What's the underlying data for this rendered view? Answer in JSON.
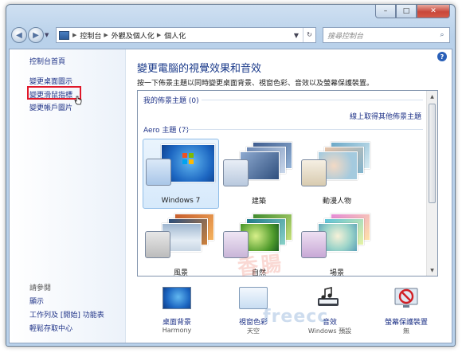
{
  "window": {
    "controls": {
      "minimize": "–",
      "maximize": "□",
      "close": "✕"
    }
  },
  "nav": {
    "breadcrumb": [
      "控制台",
      "外觀及個人化",
      "個人化"
    ],
    "search_placeholder": "搜尋控制台"
  },
  "sidebar": {
    "home": "控制台首頁",
    "links": [
      "變更桌面圖示",
      "變更滑鼠指標",
      "變更帳戶圖片"
    ],
    "see_also_title": "請參閱",
    "see_also": [
      "顯示",
      "工作列及 [開始] 功能表",
      "輕鬆存取中心"
    ]
  },
  "main": {
    "title": "變更電腦的視覺效果和音效",
    "subtitle": "按一下佈景主題以同時變更桌面背景、視窗色彩、音效以及螢幕保護裝置。",
    "my_themes": "我的佈景主題 (0)",
    "online_link": "線上取得其他佈景主題",
    "aero_themes": "Aero 主題 (7)",
    "themes": [
      {
        "label": "Windows 7",
        "selected": true
      },
      {
        "label": "建築",
        "selected": false
      },
      {
        "label": "動漫人物",
        "selected": false
      },
      {
        "label": "風景",
        "selected": false
      },
      {
        "label": "自然",
        "selected": false
      },
      {
        "label": "場景",
        "selected": false
      }
    ]
  },
  "bottom": [
    {
      "label": "桌面背景",
      "sub": "Harmony",
      "icon": "desktop-background-icon"
    },
    {
      "label": "視窗色彩",
      "sub": "天空",
      "icon": "window-color-icon"
    },
    {
      "label": "音效",
      "sub": "Windows 預設",
      "icon": "sounds-icon"
    },
    {
      "label": "螢幕保護裝置",
      "sub": "無",
      "icon": "screensaver-icon"
    }
  ],
  "colors": {
    "link": "#1e3287",
    "highlight_box": "#e0182a",
    "title": "#1a3a8a"
  }
}
